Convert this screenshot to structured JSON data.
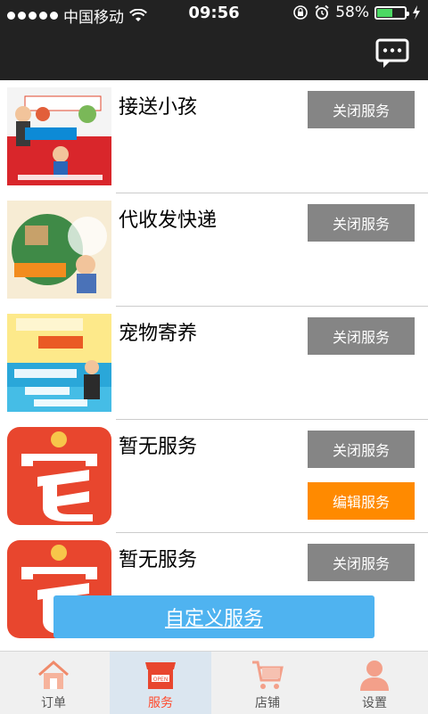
{
  "status_bar": {
    "carrier": "中国移动",
    "time": "09:56",
    "battery": "58%",
    "battery_level": 0.58
  },
  "services": [
    {
      "title": "接送小孩",
      "close_label": "关闭服务",
      "thumb": "child-pickup-promo"
    },
    {
      "title": "代收发快递",
      "close_label": "关闭服务",
      "thumb": "parcel-promo"
    },
    {
      "title": "宠物寄养",
      "close_label": "关闭服务",
      "thumb": "pet-boarding-promo"
    },
    {
      "title": "暂无服务",
      "close_label": "关闭服务",
      "edit_label": "编辑服务",
      "thumb": "zhai-logo"
    },
    {
      "title": "暂无服务",
      "close_label": "关闭服务",
      "thumb": "zhai-logo"
    }
  ],
  "custom_service_label": "自定义服务",
  "tabs": [
    {
      "label": "订单",
      "icon": "home-icon"
    },
    {
      "label": "服务",
      "icon": "shop-open-icon",
      "active": true
    },
    {
      "label": "店铺",
      "icon": "cart-icon"
    },
    {
      "label": "设置",
      "icon": "user-icon"
    }
  ],
  "colors": {
    "close": "#858585",
    "edit": "#ff8a00",
    "custom": "#4fb3f0",
    "active_tab": "#ff4b2e",
    "bar": "#222222"
  }
}
